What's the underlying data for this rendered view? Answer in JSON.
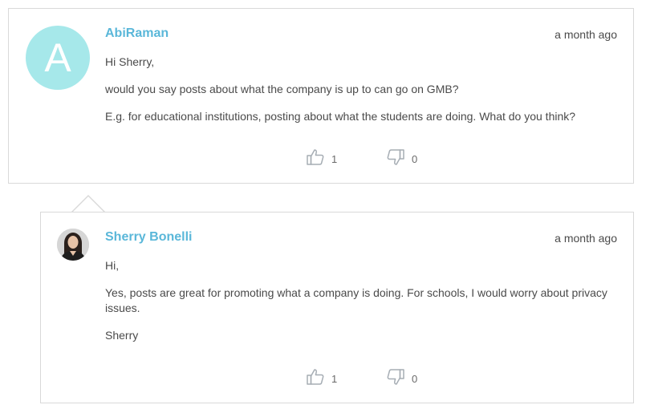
{
  "comments": [
    {
      "author": "AbiRaman",
      "avatar_letter": "A",
      "timestamp": "a month ago",
      "paragraphs": [
        "Hi Sherry,",
        "would you say posts about what the company is up to can go on GMB?",
        "E.g. for educational institutions, posting about what the students are doing. What do you think?"
      ],
      "likes": "1",
      "dislikes": "0"
    },
    {
      "author": "Sherry Bonelli",
      "timestamp": "a month ago",
      "paragraphs": [
        "Hi,",
        "Yes, posts are great for promoting what a company is doing. For schools, I would worry about privacy issues.",
        "Sherry"
      ],
      "likes": "1",
      "dislikes": "0"
    }
  ],
  "colors": {
    "author_link": "#5ab7d9",
    "avatar_bg": "#a6e8ea",
    "border": "#d9d9d9",
    "icon": "#a6adb4"
  },
  "icons": {
    "like": "thumbs-up-icon",
    "dislike": "thumbs-down-icon"
  }
}
